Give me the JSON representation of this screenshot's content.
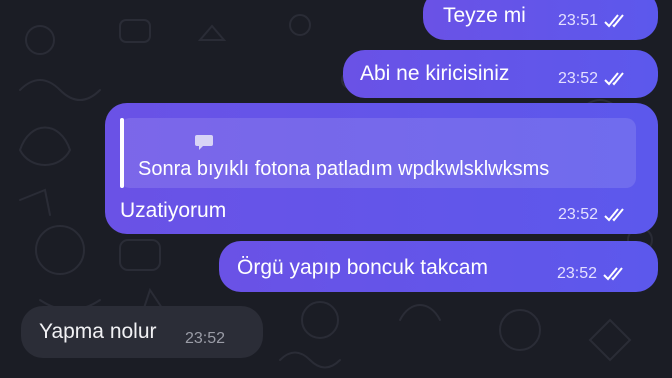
{
  "chat": {
    "messages": [
      {
        "text": "Teyze mi",
        "time": "23:51",
        "direction": "outgoing",
        "status": "read"
      },
      {
        "text": "Abi ne kiricisiniz",
        "time": "23:52",
        "direction": "outgoing",
        "status": "read"
      },
      {
        "text": "Uzatiyorum",
        "time": "23:52",
        "direction": "outgoing",
        "status": "read",
        "reply": {
          "quoted_text": "Sonra bıyıklı fotona patladım wpdkwlsklwksms",
          "icon": "message-icon"
        }
      },
      {
        "text": "Örgü yapıp boncuk takcam",
        "time": "23:52",
        "direction": "outgoing",
        "status": "read"
      },
      {
        "text": "Yapma nolur",
        "time": "23:52",
        "direction": "incoming"
      }
    ]
  },
  "colors": {
    "background": "#1b1d25",
    "outgoing_bubble": "#6a52e6",
    "incoming_bubble": "#2b2d37"
  }
}
